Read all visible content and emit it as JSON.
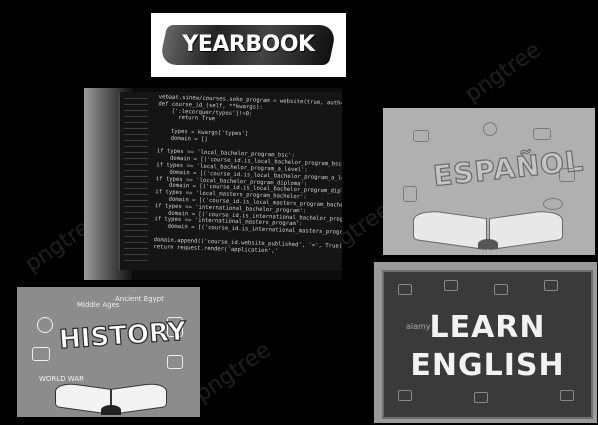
{
  "yearbook": {
    "text": "YEARBOOK"
  },
  "code": {
    "lines": [
      "  vebaat.sinew/courses.soko_program = website(true, auth='none',",
      "  def course_id_(self, **kwargs):",
      "      [':lecorquer/types']!=0:",
      "        return True",
      "",
      "      types = kwargs['types']",
      "      domain = []",
      "",
      "  if types == 'local_bachelor_program_bsc':",
      "      domain = [('course_id.is_local_bachelor_program_bsc', '='",
      "  if types == 'local_bachelor_program_a_level':",
      "      domain = [('course_id.is_local_bachelor_program_a_level'",
      "  if types == 'local_bachelor_program_diploma':",
      "      domain = [('course_id.is_local_bachelor_program_diplom",
      "  if types == 'local_masters_program_bachelor':",
      "      domain = [('course_id.is_local_masters_program_bachelor",
      "  if types == 'international_bachelor_program':",
      "      domain = [('course_id.is_international_bachelor_prog",
      "  if types == 'international_masters_program':",
      "      domain = [('course_id.is_international_masters_progra",
      "",
      "  domain.append(('course_id.website_published', '=', True))",
      "  return request.render('application','"
    ]
  },
  "espanol": {
    "title": "ESPAÑOL"
  },
  "history": {
    "title": "HISTORY",
    "labels": [
      "WORLD WAR",
      "Ancient Egypt",
      "Middle Ages"
    ]
  },
  "english": {
    "line1": "LEARN",
    "line2": "ENGLISH",
    "watermark": "alamy"
  },
  "watermarks": [
    "pngtree",
    "pngtree",
    "pngtree",
    "pngtree"
  ]
}
